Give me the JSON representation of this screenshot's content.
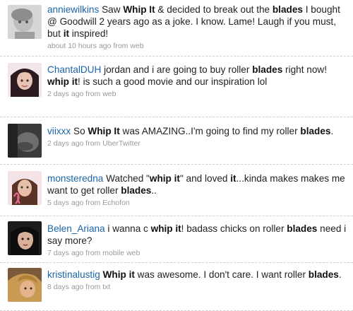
{
  "tweets": [
    {
      "user": "anniewilkins",
      "segments": [
        {
          "t": "Saw "
        },
        {
          "t": "Whip It",
          "b": true
        },
        {
          "t": " & decided to break out the "
        },
        {
          "t": "blades",
          "b": true
        },
        {
          "t": " I bought @ Goodwill 2 years ago as a joke. I know. Lame! Laugh if you must, but "
        },
        {
          "t": "it",
          "b": true
        },
        {
          "t": " inspired!"
        }
      ],
      "time": "about 10 hours ago",
      "source": "web",
      "avatar_icon": "avatar-child-photo"
    },
    {
      "user": "ChantalDUH",
      "segments": [
        {
          "t": "jordan and i are going to buy roller "
        },
        {
          "t": "blades",
          "b": true
        },
        {
          "t": " right now! "
        },
        {
          "t": "whip it",
          "b": true
        },
        {
          "t": "! is such a good movie and our inspiration lol"
        }
      ],
      "time": "2 days ago",
      "source": "web",
      "avatar_icon": "avatar-girl-photo"
    },
    {
      "user": "viixxx",
      "segments": [
        {
          "t": "So "
        },
        {
          "t": "Whip It",
          "b": true
        },
        {
          "t": " was AMAZING..I'm going to find my roller "
        },
        {
          "t": "blades",
          "b": true
        },
        {
          "t": "."
        }
      ],
      "time": "2 days ago",
      "source": "UberTwitter",
      "avatar_icon": "avatar-dark-photo"
    },
    {
      "user": "monsteredna",
      "segments": [
        {
          "t": "Watched \""
        },
        {
          "t": "whip it",
          "b": true
        },
        {
          "t": "\" and loved "
        },
        {
          "t": "it",
          "b": true
        },
        {
          "t": "...kinda makes makes me want to get roller "
        },
        {
          "t": "blades",
          "b": true
        },
        {
          "t": ".."
        }
      ],
      "time": "5 days ago",
      "source": "Echofon",
      "avatar_icon": "avatar-pink-ribbon"
    },
    {
      "user": "Belen_Ariana",
      "segments": [
        {
          "t": "i wanna c "
        },
        {
          "t": "whip it",
          "b": true
        },
        {
          "t": "! badass chicks on roller "
        },
        {
          "t": "blades",
          "b": true
        },
        {
          "t": " need i say more?"
        }
      ],
      "time": "7 days ago",
      "source": "mobile web",
      "avatar_icon": "avatar-woman-photo"
    },
    {
      "user": "kristinalustig",
      "segments": [
        {
          "t": "Whip it",
          "b": true
        },
        {
          "t": " was awesome. I don't care. I want roller "
        },
        {
          "t": "blades",
          "b": true
        },
        {
          "t": "."
        }
      ],
      "time": "8 days ago",
      "source": "txt",
      "avatar_icon": "avatar-blonde-photo"
    }
  ],
  "labels": {
    "from": "from"
  },
  "colors": {
    "username": "#1a64a8",
    "meta": "#9a9a9a",
    "divider": "#cfcfcf"
  }
}
